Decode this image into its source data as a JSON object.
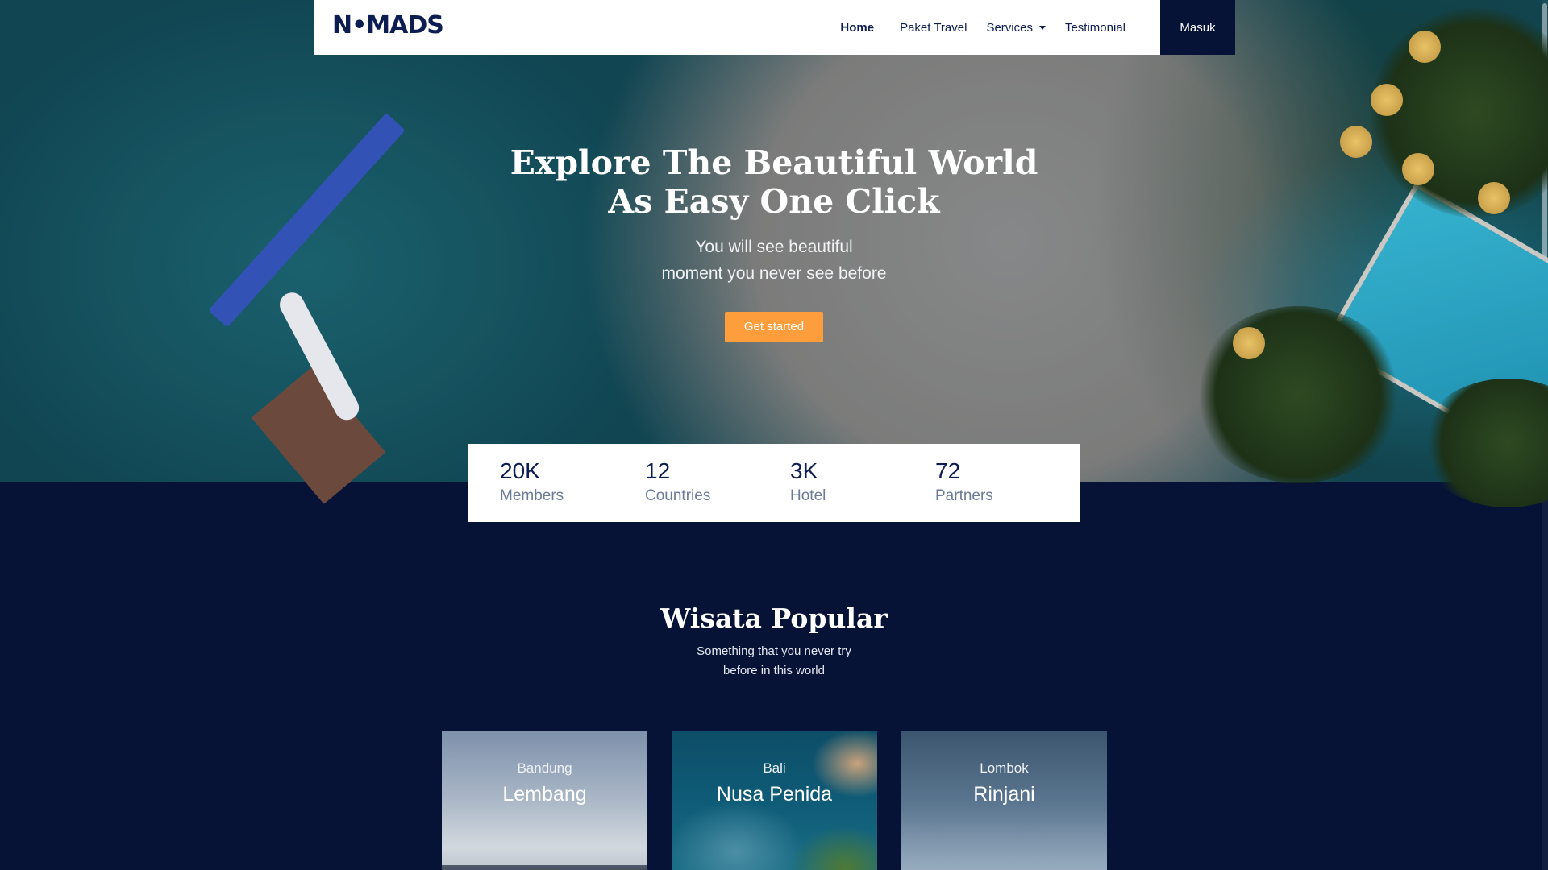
{
  "navbar": {
    "logo": "N•MADS",
    "links": [
      {
        "label": "Home",
        "active": true
      },
      {
        "label": "Paket Travel",
        "active": false
      },
      {
        "label": "Services",
        "active": false,
        "dropdown": true
      },
      {
        "label": "Testimonial",
        "active": false
      }
    ],
    "login_label": "Masuk"
  },
  "hero": {
    "title_line1": "Explore The Beautiful World",
    "title_line2": "As Easy One Click",
    "subtitle_line1": "You will see beautiful",
    "subtitle_line2": "moment you never see before",
    "cta_label": "Get started"
  },
  "stats": [
    {
      "value": "20K",
      "label": "Members"
    },
    {
      "value": "12",
      "label": "Countries"
    },
    {
      "value": "3K",
      "label": "Hotel"
    },
    {
      "value": "72",
      "label": "Partners"
    }
  ],
  "popular": {
    "title": "Wisata Popular",
    "subtitle_line1": "Something that you never try",
    "subtitle_line2": "before in this world",
    "cards": [
      {
        "region": "Bandung",
        "name": "Lembang"
      },
      {
        "region": "Bali",
        "name": "Nusa Penida"
      },
      {
        "region": "Lombok",
        "name": "Rinjani"
      }
    ]
  },
  "colors": {
    "navy": "#061337",
    "brand_text": "#0c1d52",
    "accent_orange": "#fe9d3c",
    "white": "#ffffff"
  }
}
